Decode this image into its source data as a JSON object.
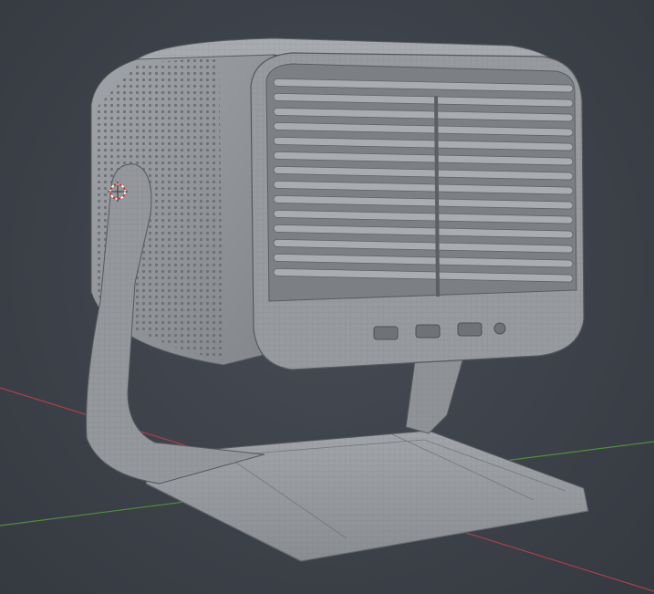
{
  "viewport": {
    "background": "#3d4149",
    "axis_x_color": "#a8414a",
    "axis_y_color": "#4f8f3c",
    "mesh_color": "#8e9196",
    "wire_color": "#5f6266",
    "cursor_color": "#e0302c",
    "icons": {
      "cursor": "3d-cursor-icon"
    }
  },
  "model": {
    "ports": [
      {
        "name": "usb-port"
      },
      {
        "name": "hdmi-port"
      },
      {
        "name": "hdmi-port-2"
      },
      {
        "name": "audio-jack"
      }
    ]
  }
}
